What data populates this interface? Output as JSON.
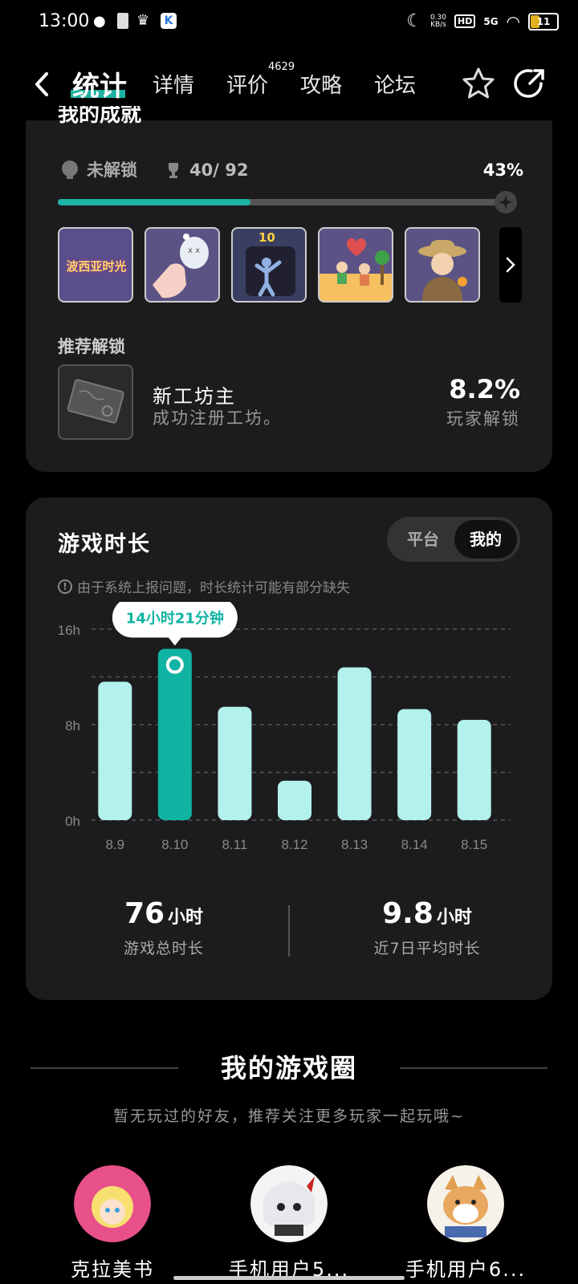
{
  "status_bar": {
    "time": "13:00",
    "net_speed": "0.30",
    "net_unit": "KB/s",
    "hd": "HD",
    "signal": "5G",
    "battery": "11"
  },
  "nav": {
    "tabs": [
      {
        "label": "统计"
      },
      {
        "label": "详情"
      },
      {
        "label": "评价"
      },
      {
        "label": "攻略"
      },
      {
        "label": "论坛"
      }
    ],
    "review_count": "4629"
  },
  "achievements": {
    "title": "我的成就",
    "locked_label": "未解锁",
    "progress_text": "40/ 92",
    "progress_percent": "43%",
    "progress_fraction": 0.43,
    "badge1_text": "波西亚时光",
    "badge3_text": "10",
    "recommend_label": "推荐解锁",
    "rec_name": "新工坊主",
    "rec_desc": "成功注册工坊。",
    "rec_pct": "8.2%",
    "rec_pct_label": "玩家解锁"
  },
  "playtime": {
    "title": "游戏时长",
    "toggle_platform": "平台",
    "toggle_mine": "我的",
    "notice": "由于系统上报问题，时长统计可能有部分缺失",
    "tooltip": "14小时21分钟",
    "total_value": "76",
    "total_unit": "小时",
    "total_label": "游戏总时长",
    "avg_value": "9.8",
    "avg_unit": "小时",
    "avg_label": "近7日平均时长"
  },
  "chart_data": {
    "type": "bar",
    "categories": [
      "8.9",
      "8.10",
      "8.11",
      "8.12",
      "8.13",
      "8.14",
      "8.15"
    ],
    "values": [
      11.6,
      14.35,
      9.5,
      3.3,
      12.8,
      9.3,
      8.4
    ],
    "highlight_index": 1,
    "ylim": [
      0,
      16
    ],
    "yticks": [
      "0h",
      "8h",
      "16h"
    ],
    "ytick_values": [
      0,
      8,
      16
    ],
    "grid": true,
    "bar_color": "#b3f1ec",
    "highlight_color": "#11b3a2"
  },
  "game_circle": {
    "title": "我的游戏圈",
    "subtitle": "暂无玩过的好友，推荐关注更多玩家一起玩哦~",
    "friends": [
      {
        "name": "克拉美书"
      },
      {
        "name": "手机用户5..."
      },
      {
        "name": "手机用户6..."
      }
    ]
  },
  "colors": {
    "accent": "#1bb3a3",
    "card_bg": "#1c1c1e"
  }
}
